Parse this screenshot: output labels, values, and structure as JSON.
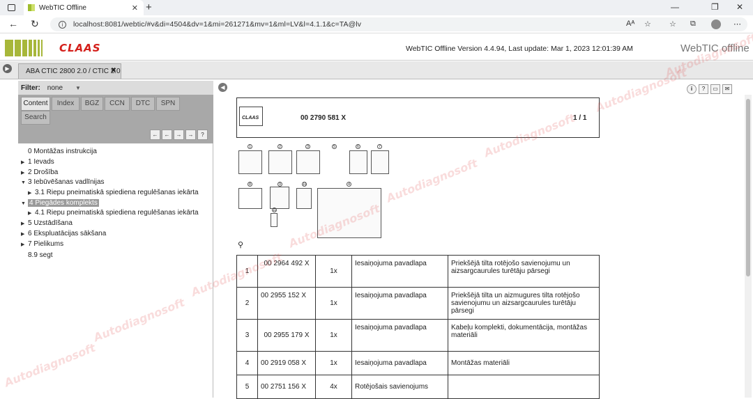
{
  "browser": {
    "tab_title": "WebTIC Offline",
    "url": "localhost:8081/webtic/#v&di=4504&dv=1&mi=261271&mv=1&ml=LV&l=4.1.1&c=TA@lv"
  },
  "header": {
    "brand": "CLAAS",
    "version_text": "WebTIC Offline Version 4.4.94, Last update: Mar 1, 2023 12:01:39 AM",
    "product": "WebTIC offline"
  },
  "doc_tab": {
    "label": "ABA CTIC 2800 2.0 / CTIC 2.0"
  },
  "filter": {
    "label": "Filter:",
    "value": "none"
  },
  "panel_tabs": [
    "Content",
    "Index",
    "BGZ",
    "CCN",
    "DTC",
    "SPN",
    "Search"
  ],
  "nav_buttons": [
    "←",
    "←",
    "→",
    "→",
    "?"
  ],
  "tree": [
    {
      "label": "0 Montāžas instrukcija",
      "arrow": ""
    },
    {
      "label": "1 Ievads",
      "arrow": "▶"
    },
    {
      "label": "2 Drošība",
      "arrow": "▶"
    },
    {
      "label": "3 Iebūvēšanas vadlīnijas",
      "arrow": "▼"
    },
    {
      "label": "3.1 Riepu pneimatiskā spiediena regulēšanas iekārta",
      "arrow": "▶"
    },
    {
      "label": "4 Piegādes komplekts",
      "arrow": "▼"
    },
    {
      "label": "4.1 Riepu pneimatiskā spiediena regulēšanas iekārta",
      "arrow": "▶"
    },
    {
      "label": "5 Uzstādīšana",
      "arrow": "▶"
    },
    {
      "label": "6 Ekspluatācijas sākšana",
      "arrow": "▶"
    },
    {
      "label": "7 Pielikums",
      "arrow": "▶"
    },
    {
      "label": "8.9 segt",
      "arrow": ""
    }
  ],
  "document": {
    "logo": "CLAAS",
    "part_number": "00 2790 581 X",
    "page": "1 / 1",
    "callouts": [
      "1",
      "2",
      "3",
      "5",
      "6",
      "7",
      "8",
      "9",
      "10",
      "11",
      "4"
    ]
  },
  "parts_table": [
    {
      "pos": "1",
      "number": "00 2964 492 X",
      "qty": "1x",
      "type": "Iesaiņojuma pavadlapa",
      "desc": "Priekšējā tilta rotējošo savienojumu un aizsargcaurules turētāju pārsegi"
    },
    {
      "pos": "2",
      "number": "00 2955 152 X",
      "qty": "1x",
      "type": "Iesaiņojuma pavadlapa",
      "desc": "Priekšējā tilta un aizmugures tilta rotējošo savienojumu un aizsargcaurules turētāju pārsegi"
    },
    {
      "pos": "3",
      "number": "00 2955 179 X",
      "qty": "1x",
      "type": "Iesaiņojuma pavadlapa",
      "desc": "Kabeļu komplekti, dokumentācija, montāžas materiāli"
    },
    {
      "pos": "4",
      "number": "00 2919 058 X",
      "qty": "1x",
      "type": "Iesaiņojuma pavadlapa",
      "desc": "Montāžas materiāli"
    },
    {
      "pos": "5",
      "number": "00 2751 156 X",
      "qty": "4x",
      "type": "Rotējošais savienojums",
      "desc": ""
    }
  ],
  "watermark": "Autodiagnosoft"
}
